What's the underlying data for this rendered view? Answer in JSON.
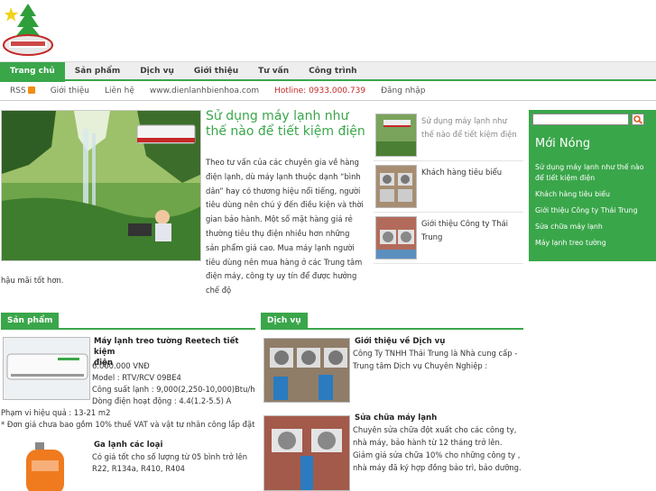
{
  "logo": {
    "company": "THAI TRUNG CO., LTD"
  },
  "main_nav": [
    "Trang chủ",
    "Sản phẩm",
    "Dịch vụ",
    "Giới thiệu",
    "Tư vấn",
    "Công trình"
  ],
  "sub_nav": {
    "rss": "RSS",
    "about": "Giới thiệu",
    "contact": "Liên hệ",
    "website": "www.dienlanhbienhoa.com",
    "hotline": "Hotline: 0933.000.739",
    "login": "Đăng nhập"
  },
  "featured": {
    "title": "Sử dụng máy lạnh như thế nào để tiết kiệm điện",
    "text": "Theo tư vấn của các chuyên gia về hàng điện lạnh, dù máy lạnh thuộc dạnh “bình dân” hay có thương hiệu nổi tiếng, người tiêu dùng nên chú ý đến điều kiện và thời gian bảo hành. Một số mặt hàng giá rẻ thường tiêu thụ điện nhiều hơn những sản phẩm giá cao. Mua máy lạnh người tiêu dùng nên mua hàng ở các Trung tâm điện máy, công ty uy tín để được hưởng chế độ",
    "text_tail": "hậu mãi tốt hơn."
  },
  "side_articles": [
    "Sử dụng máy lạnh như thế nào để tiết kiệm điện",
    "Khách hàng tiêu biểu",
    "Giới thiệu Công ty Thái Trung"
  ],
  "right_box": {
    "title": "Mới Nóng",
    "items": [
      "Sử dụng máy lạnh như thế nào để tiết kiệm điện",
      "Khách hàng tiêu biểu",
      "Giới thiệu Công ty Thái Trung",
      "Sửa chữa máy lạnh",
      "Máy lạnh treo tường"
    ]
  },
  "products": {
    "heading": "Sản phẩm",
    "items": [
      {
        "title_line1": "Máy lạnh treo tường Reetech tiết kiệm",
        "title_line2": "điện",
        "lines": [
          "6.000.000 VNĐ",
          "Model : RTV/RCV 09BE4",
          "Công suất lạnh : 9,000(2,250-10,000)Btu/h",
          "Dòng điện hoạt động : 4.4(1.2-5.5) A"
        ],
        "tail": [
          "Phạm vi hiệu quả : 13-21 m2",
          "* Đơn giá chưa bao gồm 10% thuế VAT và vật tư nhân công lắp đặt"
        ]
      },
      {
        "title_line1": "Ga lạnh các loại",
        "lines": [
          "Có giá tốt cho số lượng từ 05 bình trở lên",
          "R22, R134a, R410, R404"
        ]
      }
    ]
  },
  "services": {
    "heading": "Dịch vụ",
    "items": [
      {
        "title": "Giới thiệu về Dịch vụ",
        "lines": [
          "Công Ty TNHH Thái Trung là Nhà cung cấp -",
          "Trung tâm Dịch vụ Chuyên Nghiệp :"
        ]
      },
      {
        "title": "Sửa chữa máy lạnh",
        "lines": [
          "Chuyên sửa chữa đột xuất cho các công ty,",
          "nhà máy, bảo hành từ 12 tháng trở lên.",
          "Giảm giá sửa chữa 10% cho những công ty ,",
          "nhà máy đã ký hợp đồng bảo trì, bảo dưỡng."
        ]
      }
    ]
  }
}
